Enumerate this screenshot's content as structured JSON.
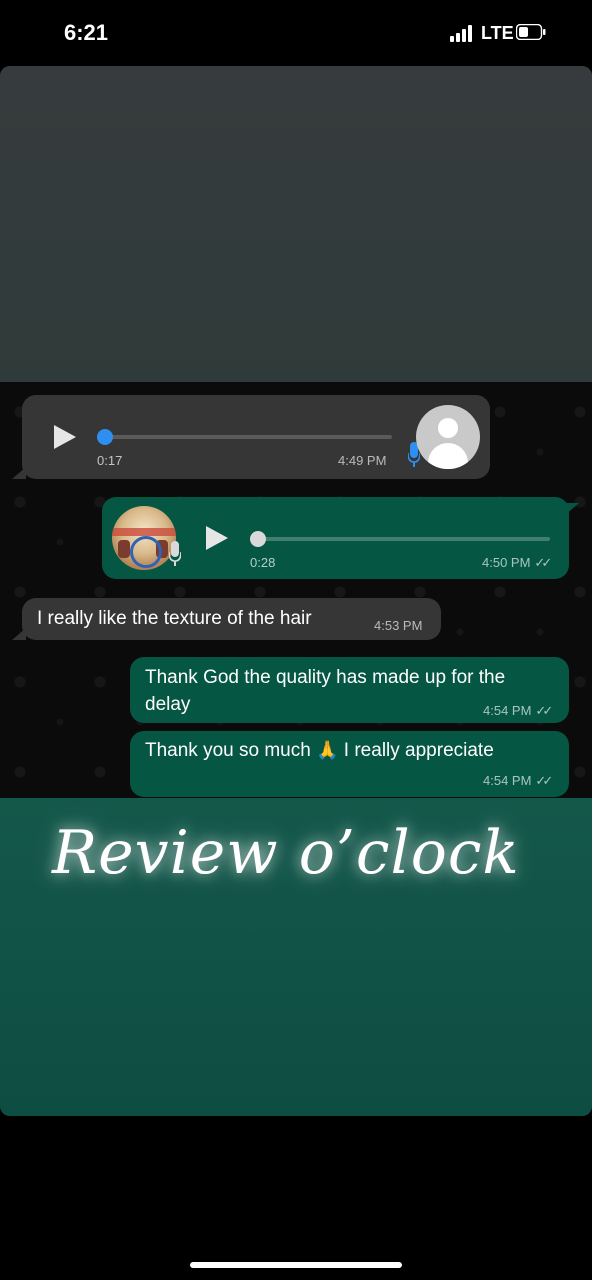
{
  "status_bar": {
    "time": "6:21",
    "network": "LTE"
  },
  "messages": [
    {
      "type": "voice",
      "direction": "incoming",
      "duration": "0:17",
      "time": "4:49 PM",
      "progress": 0.0
    },
    {
      "type": "voice",
      "direction": "outgoing",
      "duration": "0:28",
      "time": "4:50 PM",
      "progress": 0.0,
      "read": true
    },
    {
      "type": "text",
      "direction": "incoming",
      "text": "I really like the texture of the hair",
      "time": "4:53 PM"
    },
    {
      "type": "text",
      "direction": "outgoing",
      "text": "Thank God the quality has made up for the delay",
      "time": "4:54 PM",
      "read": true
    },
    {
      "type": "text",
      "direction": "outgoing",
      "text_before": "Thank you so much",
      "emoji": "🙏",
      "text_after": "I really appreciate",
      "time": "4:54 PM",
      "read": true
    }
  ],
  "overlay": {
    "caption": "Review o’clock"
  },
  "colors": {
    "incoming_bubble": "#363636",
    "outgoing_bubble": "#055744",
    "voice_accent": "#2e8ff0",
    "caption_panel": "#14584b"
  },
  "icons": [
    "play-icon",
    "microphone-icon",
    "avatar-placeholder-icon",
    "double-check-icon",
    "signal-icon",
    "battery-icon"
  ]
}
